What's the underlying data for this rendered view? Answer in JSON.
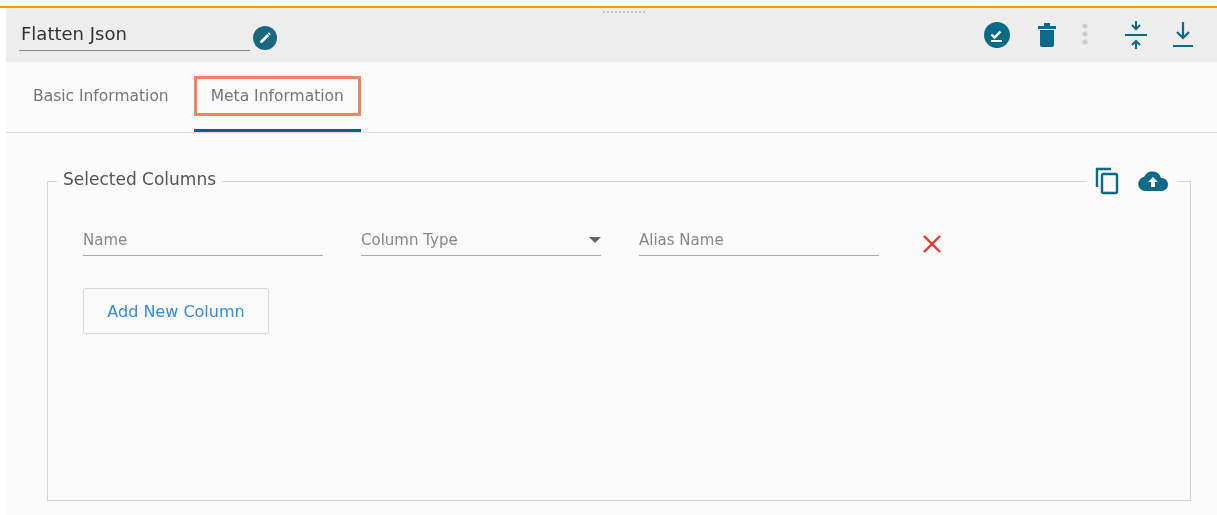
{
  "header": {
    "title": "Flatten Json"
  },
  "tabs": [
    {
      "label": "Basic Information",
      "selected": false,
      "highlighted": false
    },
    {
      "label": "Meta Information",
      "selected": true,
      "highlighted": true
    }
  ],
  "section": {
    "legend": "Selected Columns"
  },
  "fields": [
    {
      "kind": "text",
      "placeholder": "Name"
    },
    {
      "kind": "select",
      "placeholder": "Column Type"
    },
    {
      "kind": "text",
      "placeholder": "Alias Name"
    }
  ],
  "add_button": "Add New Column"
}
